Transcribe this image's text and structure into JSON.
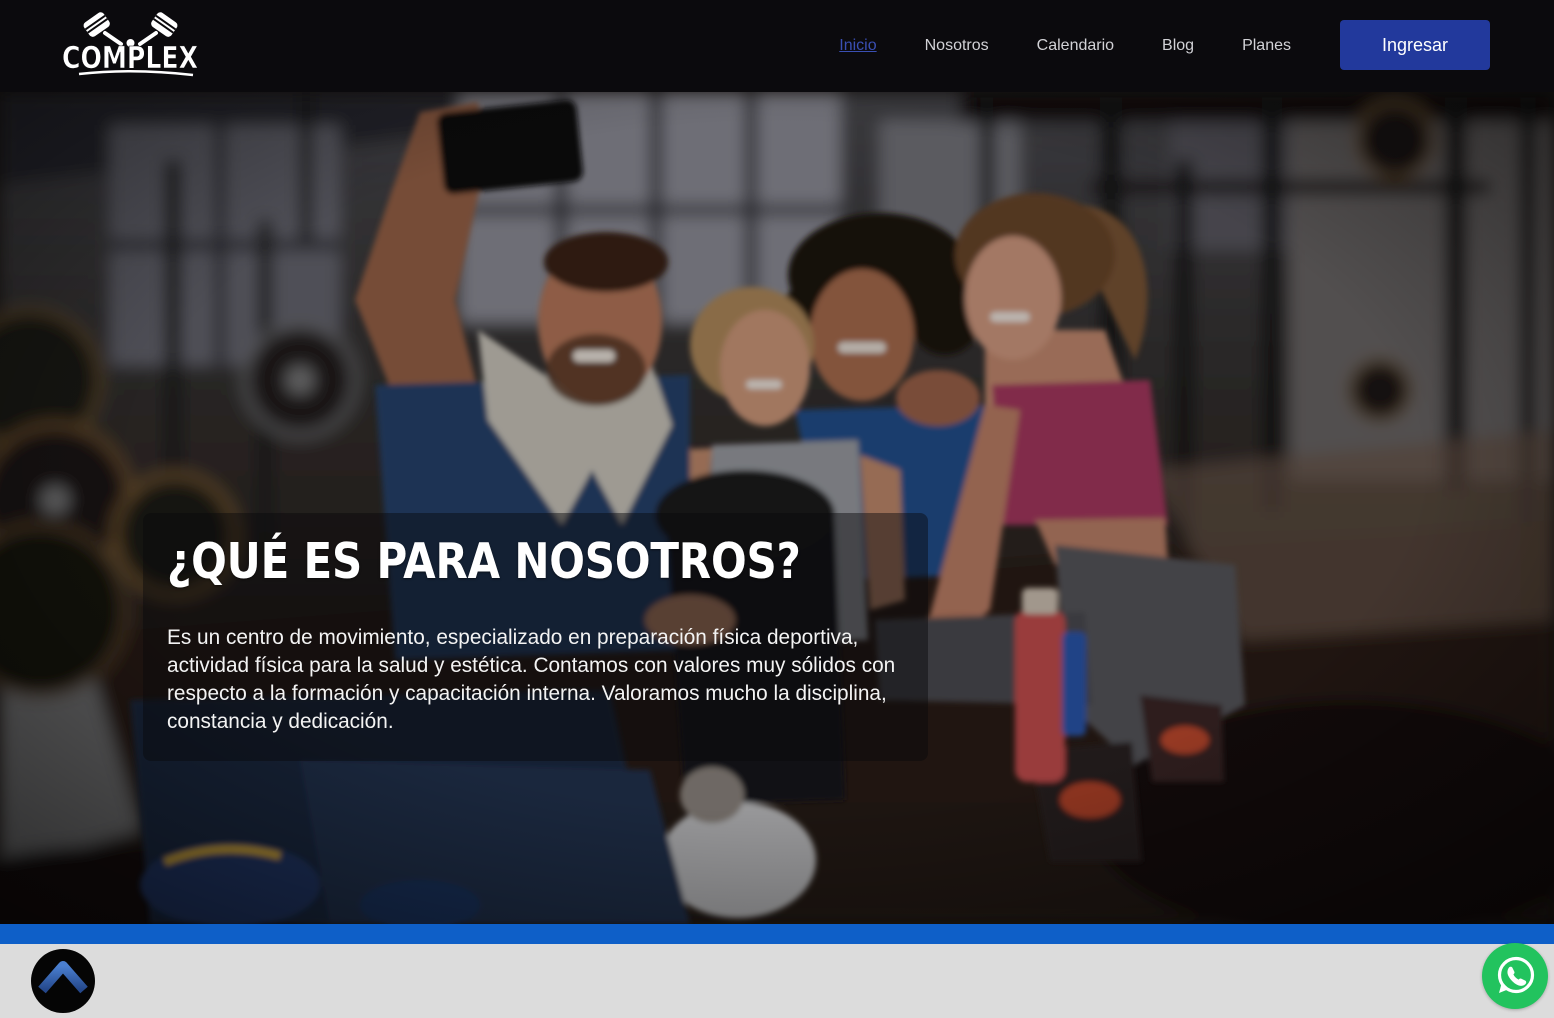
{
  "brand": {
    "name": "COMPLEX",
    "logo_icon": "crossed-pistons-icon"
  },
  "nav": {
    "items": [
      {
        "label": "Inicio",
        "active": true
      },
      {
        "label": "Nosotros",
        "active": false
      },
      {
        "label": "Calendario",
        "active": false
      },
      {
        "label": "Blog",
        "active": false
      },
      {
        "label": "Planes",
        "active": false
      }
    ],
    "login_label": "Ingresar"
  },
  "hero": {
    "title": "¿QUÉ ES PARA NOSOTROS?",
    "description": "Es un centro de movimiento, especializado en preparación física deportiva, actividad física para la salud y estética. Contamos con valores muy sólidos con respecto a la formación y capacitación interna. Valoramos mucho la disciplina, constancia y dedicación."
  },
  "floating_buttons": {
    "scroll_top_icon": "chevron-up-icon",
    "whatsapp_icon": "whatsapp-icon"
  },
  "colors": {
    "nav_background": "#0b0a0d",
    "nav_link": "#d2d2d6",
    "nav_active": "#3a4fb3",
    "button": "#22399c",
    "stripe": "#0e5fc8",
    "footer_background": "#dcdcdc",
    "whatsapp": "#22c35e",
    "scroll_top_chevron": "#3467b8"
  }
}
